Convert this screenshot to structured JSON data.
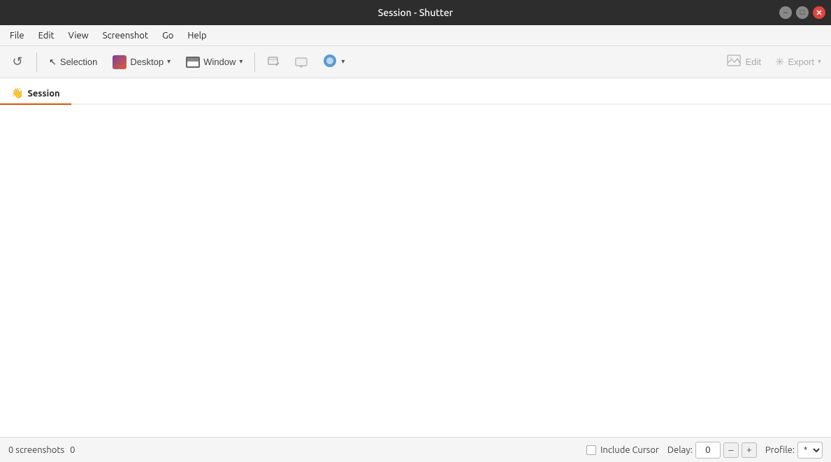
{
  "titlebar": {
    "title": "Session - Shutter",
    "minimize_label": "–",
    "maximize_label": "□",
    "close_label": "✕"
  },
  "menubar": {
    "items": [
      {
        "id": "file",
        "label": "File"
      },
      {
        "id": "edit",
        "label": "Edit"
      },
      {
        "id": "view",
        "label": "View"
      },
      {
        "id": "screenshot",
        "label": "Screenshot"
      },
      {
        "id": "go",
        "label": "Go"
      },
      {
        "id": "help",
        "label": "Help"
      }
    ]
  },
  "toolbar": {
    "reload_tooltip": "Reload",
    "selection_label": "Selection",
    "desktop_label": "Desktop",
    "window_label": "Window",
    "edit_label": "Edit",
    "export_label": "Export",
    "dropdown_arrow": "▾"
  },
  "tabs": [
    {
      "id": "session",
      "label": "Session",
      "icon": "👋",
      "active": true
    }
  ],
  "statusbar": {
    "screenshots_count": "0 screenshots",
    "extra_count": "0",
    "include_cursor_label": "Include Cursor",
    "delay_label": "Delay:",
    "delay_value": "0",
    "minus_label": "–",
    "plus_label": "+",
    "profile_label": "Profile:",
    "profile_value": "*",
    "profile_dropdown": "▾"
  }
}
